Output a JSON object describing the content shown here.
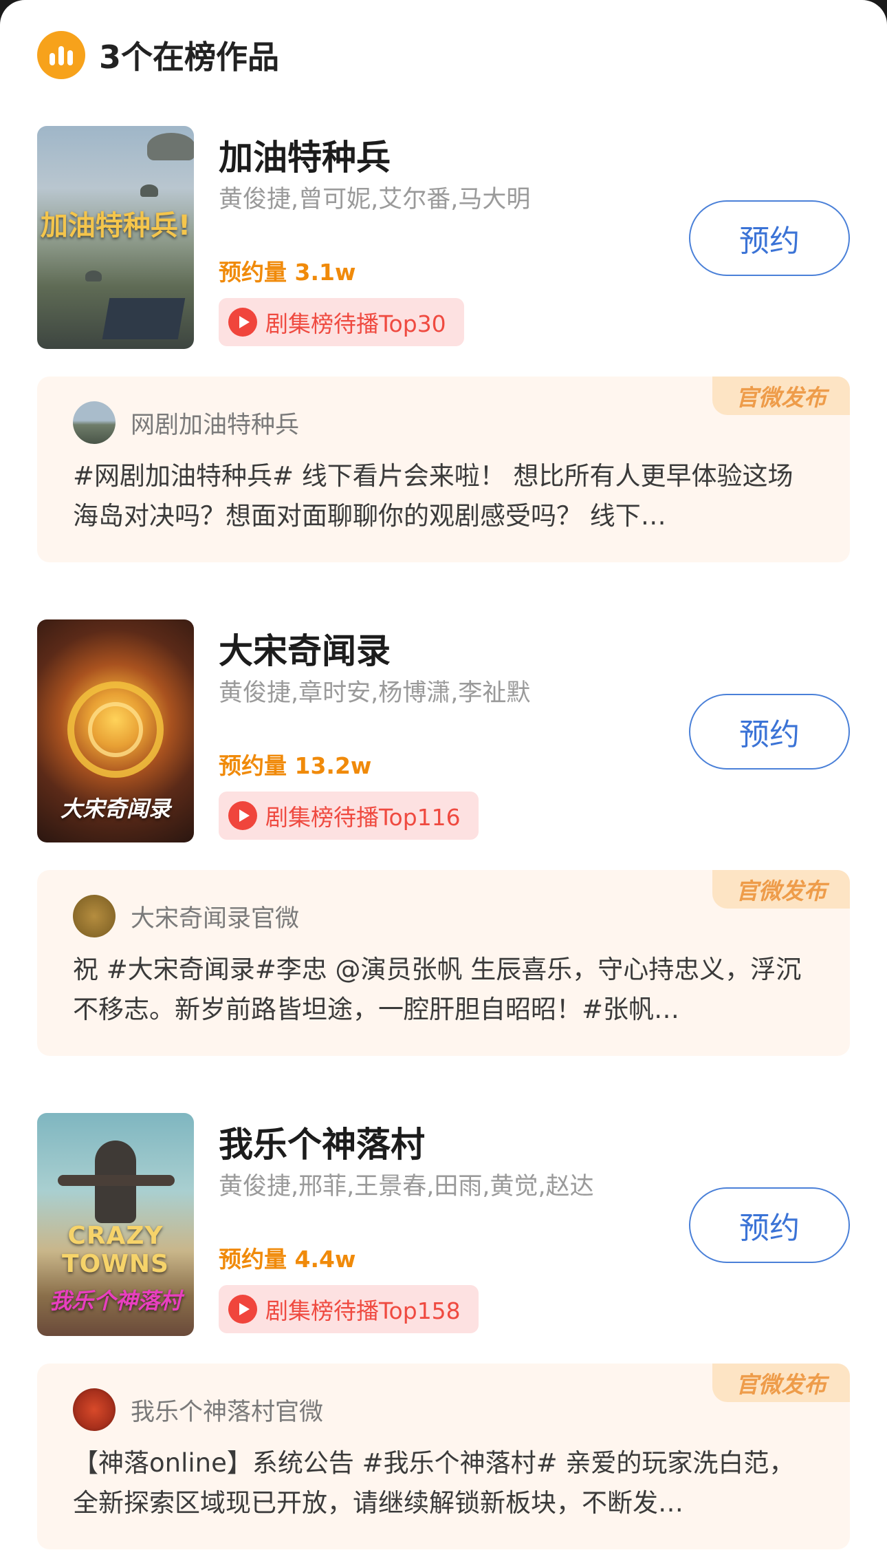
{
  "header": {
    "title": "3个在榜作品",
    "icon": "chart-icon"
  },
  "items": [
    {
      "name": "加油特种兵",
      "cast": "黄俊捷,曾可妮,艾尔番,马大明",
      "reservations": "预约量 3.1w",
      "rank": "剧集榜待播Top30",
      "button": "预约",
      "poster_text": "加油特种兵!",
      "badge": "官微发布",
      "author": "网剧加油特种兵",
      "post": "#网剧加油特种兵# 线下看片会来啦！ 想比所有人更早体验这场海岛对决吗？想面对面聊聊你的观剧感受吗？ 线下…"
    },
    {
      "name": "大宋奇闻录",
      "cast": "黄俊捷,章时安,杨博潇,李祉默",
      "reservations": "预约量 13.2w",
      "rank": "剧集榜待播Top116",
      "button": "预约",
      "poster_text": "大宋奇闻录",
      "badge": "官微发布",
      "author": "大宋奇闻录官微",
      "post": "祝 #大宋奇闻录#李忠 @演员张帆 生辰喜乐，守心持忠义，浮沉不移志。新岁前路皆坦途，一腔肝胆自昭昭！#张帆…"
    },
    {
      "name": "我乐个神落村",
      "cast": "黄俊捷,邢菲,王景春,田雨,黄觉,赵达",
      "reservations": "预约量 4.4w",
      "rank": "剧集榜待播Top158",
      "button": "预约",
      "poster_text": "我乐个神落村",
      "poster_text_en": "CRAZY TOWNS",
      "badge": "官微发布",
      "author": "我乐个神落村官微",
      "post": "【神落online】系统公告 #我乐个神落村# 亲爱的玩家洗白范，全新探索区域现已开放，请继续解锁新板块，不断发…"
    }
  ],
  "colors": {
    "accent_orange": "#f08a0a",
    "rank_red": "#ef4a40",
    "button_blue": "#3b73d6",
    "card_bg": "#fff6ef"
  }
}
